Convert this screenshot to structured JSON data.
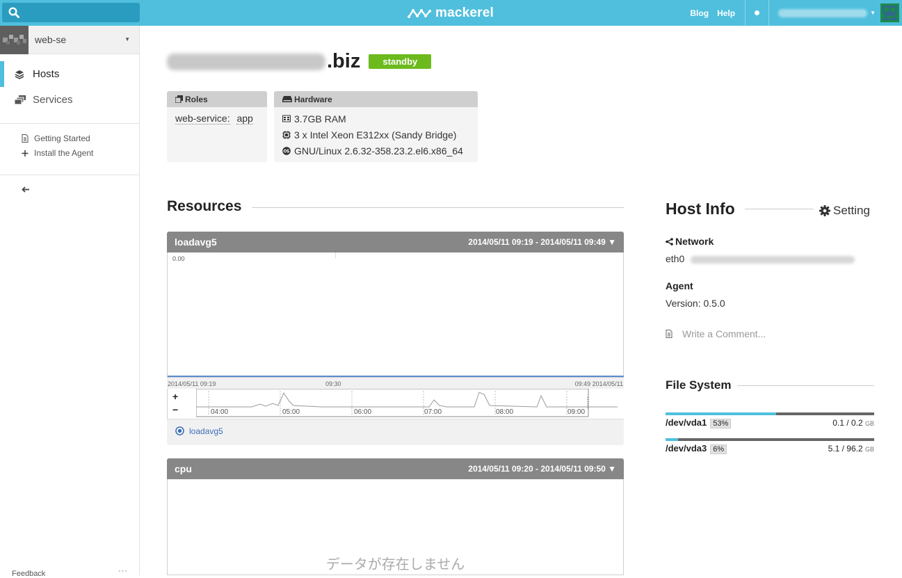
{
  "app": {
    "brand": "mackerel"
  },
  "topbar": {
    "blog": "Blog",
    "help": "Help"
  },
  "sidebar": {
    "org_name": "web-se",
    "nav": [
      {
        "label": "Hosts"
      },
      {
        "label": "Services"
      }
    ],
    "links": [
      {
        "label": "Getting Started"
      },
      {
        "label": "Install the Agent"
      }
    ],
    "feedback": "Feedback",
    "more": "···"
  },
  "host": {
    "name_tld": ".biz",
    "status": "standby",
    "roles_title": "Roles",
    "role_service": "web-service:",
    "role_name": "app",
    "hardware_title": "Hardware",
    "ram": "3.7GB RAM",
    "cpu": "3 x Intel Xeon E312xx (Sandy Bridge)",
    "os": "GNU/Linux 2.6.32-358.23.2.el6.x86_64"
  },
  "resources": {
    "title": "Resources",
    "graphs": [
      {
        "name": "loadavg5",
        "range": "2014/05/11 09:19 - 2014/05/11 09:49 ▼",
        "y_label": "0.00",
        "axis_left": "2014/05/11 09:19",
        "axis_mid": "09:30",
        "axis_right": "09:49 2014/05/11",
        "overview_ticks": [
          "04:00",
          "05:00",
          "06:00",
          "07:00",
          "08:00",
          "09:00"
        ],
        "zoom_in": "+",
        "zoom_out": "−",
        "legend": "loadavg5"
      },
      {
        "name": "cpu",
        "range": "2014/05/11 09:20 - 2014/05/11 09:50 ▼",
        "empty_message": "データが存在しません"
      }
    ]
  },
  "host_info": {
    "title": "Host Info",
    "setting": "Setting",
    "network_label": "Network",
    "interface": "eth0",
    "agent_label": "Agent",
    "agent_version": "Version: 0.5.0",
    "comment_placeholder": "Write a Comment..."
  },
  "filesystem": {
    "title": "File System",
    "disks": [
      {
        "name": "/dev/vda1",
        "pct": "53%",
        "used": "0.1",
        "total": "0.2",
        "unit": "GB",
        "fraction": 0.53
      },
      {
        "name": "/dev/vda3",
        "pct": "6%",
        "used": "5.1",
        "total": "96.2",
        "unit": "GB",
        "fraction": 0.06
      }
    ]
  },
  "colors": {
    "accent": "#4fbfdd",
    "standby": "#6cba1d",
    "graph_header": "#878787"
  }
}
